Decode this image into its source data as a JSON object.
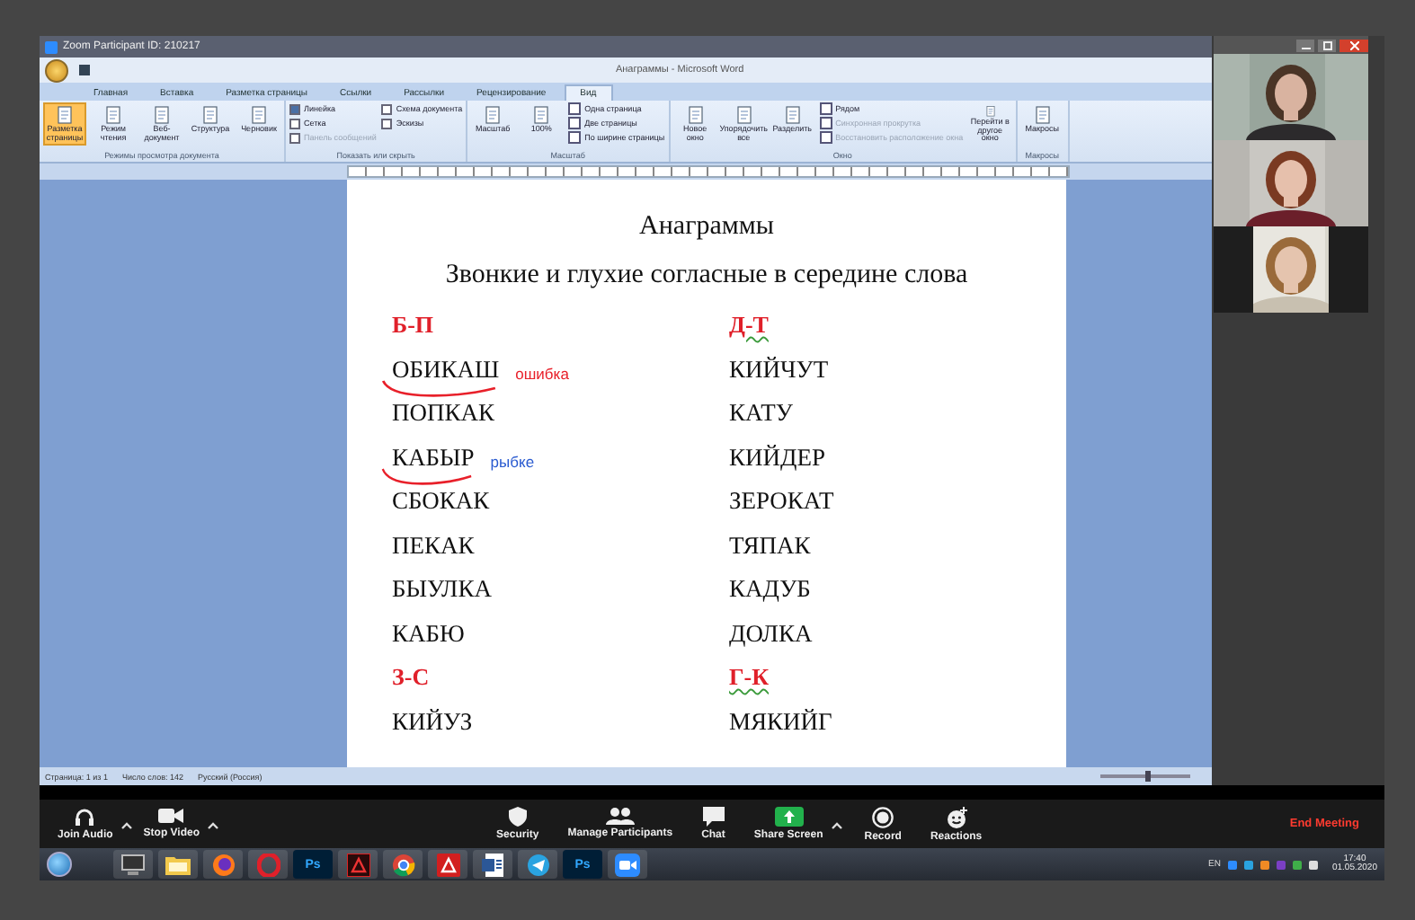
{
  "zoom_window": {
    "title": "Zoom Participant ID: 210217"
  },
  "word": {
    "title": "Анаграммы - Microsoft Word",
    "tabs": [
      {
        "label": "Главная",
        "selected": false
      },
      {
        "label": "Вставка",
        "selected": false
      },
      {
        "label": "Разметка страницы",
        "selected": false
      },
      {
        "label": "Ссылки",
        "selected": false
      },
      {
        "label": "Рассылки",
        "selected": false
      },
      {
        "label": "Рецензирование",
        "selected": false
      },
      {
        "label": "Вид",
        "selected": true
      }
    ],
    "ribbon_groups": [
      {
        "name": "Режимы просмотра документа",
        "buttons": [
          {
            "kind": "large",
            "label": "Разметка страницы",
            "selected": true,
            "disabled": false
          },
          {
            "kind": "large",
            "label": "Режим чтения",
            "selected": false,
            "disabled": false
          },
          {
            "kind": "large",
            "label": "Веб-документ",
            "selected": false,
            "disabled": false
          },
          {
            "kind": "large",
            "label": "Структура",
            "selected": false,
            "disabled": false
          },
          {
            "kind": "large",
            "label": "Черновик",
            "selected": false,
            "disabled": false
          }
        ]
      },
      {
        "name": "Показать или скрыть",
        "buttons": [
          {
            "kind": "check",
            "label": "Линейка",
            "checked": true,
            "disabled": false
          },
          {
            "kind": "check",
            "label": "Сетка",
            "checked": false,
            "disabled": false
          },
          {
            "kind": "check",
            "label": "Панель сообщений",
            "checked": false,
            "disabled": true
          },
          {
            "kind": "check",
            "label": "Схема документа",
            "checked": false,
            "disabled": false
          },
          {
            "kind": "check",
            "label": "Эскизы",
            "checked": false,
            "disabled": false
          }
        ]
      },
      {
        "name": "Масштаб",
        "buttons": [
          {
            "kind": "large",
            "label": "Масштаб",
            "selected": false,
            "disabled": false
          },
          {
            "kind": "large",
            "label": "100%",
            "selected": false,
            "disabled": false
          },
          {
            "kind": "small",
            "label": "Одна страница",
            "selected": false,
            "disabled": false
          },
          {
            "kind": "small",
            "label": "Две страницы",
            "selected": false,
            "disabled": false
          },
          {
            "kind": "small",
            "label": "По ширине страницы",
            "selected": false,
            "disabled": false
          }
        ]
      },
      {
        "name": "Окно",
        "buttons": [
          {
            "kind": "large",
            "label": "Новое окно",
            "selected": false,
            "disabled": false
          },
          {
            "kind": "large",
            "label": "Упорядочить все",
            "selected": false,
            "disabled": false
          },
          {
            "kind": "large",
            "label": "Разделить",
            "selected": false,
            "disabled": false
          },
          {
            "kind": "small",
            "label": "Рядом",
            "selected": false,
            "disabled": false
          },
          {
            "kind": "small",
            "label": "Синхронная прокрутка",
            "selected": false,
            "disabled": true
          },
          {
            "kind": "small",
            "label": "Восстановить расположение окна",
            "selected": false,
            "disabled": true
          },
          {
            "kind": "large",
            "label": "Перейти в другое окно",
            "selected": false,
            "disabled": false
          }
        ]
      },
      {
        "name": "Макросы",
        "buttons": [
          {
            "kind": "large",
            "label": "Макросы",
            "selected": false,
            "disabled": false
          }
        ]
      }
    ],
    "document": {
      "title": "Анаграммы",
      "subtitle": "Звонкие и глухие согласные в середине слова",
      "columns": [
        {
          "items": [
            {
              "kind": "heading",
              "text": "Б-П",
              "flagged": false
            },
            {
              "kind": "word",
              "text": "ОБИКАШ",
              "circled": true,
              "annotation": {
                "text": "ошибка",
                "color": "#e8202a"
              }
            },
            {
              "kind": "word",
              "text": "ПОПКАК",
              "circled": false
            },
            {
              "kind": "word",
              "text": "КАБЫР",
              "circled": true,
              "annotation": {
                "text": "рыбке",
                "color": "#2a5bd0"
              }
            },
            {
              "kind": "word",
              "text": "СБОКАК",
              "circled": false
            },
            {
              "kind": "word",
              "text": "ПЕКАК",
              "circled": false
            },
            {
              "kind": "word",
              "text": "БЫУЛКА",
              "circled": false
            },
            {
              "kind": "word",
              "text": "КАБЮ",
              "circled": false
            },
            {
              "kind": "heading",
              "text": "З-С",
              "flagged": false
            },
            {
              "kind": "word",
              "text": "КИЙУЗ",
              "circled": false
            }
          ]
        },
        {
          "items": [
            {
              "kind": "heading",
              "text": "Д-Т",
              "flagged": true
            },
            {
              "kind": "word",
              "text": "КИЙЧУТ",
              "circled": false
            },
            {
              "kind": "word",
              "text": "КАТУ",
              "circled": false
            },
            {
              "kind": "word",
              "text": "КИЙДЕР",
              "circled": false
            },
            {
              "kind": "word",
              "text": "ЗЕРОКАТ",
              "circled": false
            },
            {
              "kind": "word",
              "text": "ТЯПАК",
              "circled": false
            },
            {
              "kind": "word",
              "text": "КАДУБ",
              "circled": false
            },
            {
              "kind": "word",
              "text": "ДОЛКА",
              "circled": false
            },
            {
              "kind": "heading",
              "text": "Г-К",
              "flagged": true
            },
            {
              "kind": "word",
              "text": "МЯКИЙГ",
              "circled": false
            }
          ]
        }
      ]
    },
    "status_bar": [
      "Страница: 1 из 1",
      "Число слов: 142",
      "Русский (Россия)"
    ],
    "zoom_slider": {
      "level": 0.5
    }
  },
  "zoom_toolbar": {
    "left_controls": [
      {
        "kind": "audio",
        "label": "Join Audio",
        "caret": true
      },
      {
        "kind": "video",
        "label": "Stop Video",
        "caret": true
      }
    ],
    "center_controls": [
      {
        "kind": "security",
        "label": "Security",
        "caret": false
      },
      {
        "kind": "participants",
        "label": "Manage Participants",
        "caret": false
      },
      {
        "kind": "chat",
        "label": "Chat",
        "caret": false
      },
      {
        "kind": "share",
        "label": "Share Screen",
        "caret": true
      },
      {
        "kind": "record",
        "label": "Record",
        "caret": false
      },
      {
        "kind": "reactions",
        "label": "Reactions",
        "caret": false
      }
    ],
    "end_button": "End Meeting"
  },
  "taskbar": {
    "apps": [
      {
        "kind": "explorer"
      },
      {
        "kind": "folder"
      },
      {
        "kind": "firefox"
      },
      {
        "kind": "opera"
      },
      {
        "kind": "photoshop",
        "label": "Ps"
      },
      {
        "kind": "acrobat"
      },
      {
        "kind": "chrome"
      },
      {
        "kind": "reader"
      },
      {
        "kind": "word"
      },
      {
        "kind": "telegram"
      },
      {
        "kind": "photoshop",
        "label": "Ps"
      },
      {
        "kind": "zoom"
      }
    ],
    "language": "EN",
    "time": "17:40",
    "date": "01.05.2020"
  }
}
